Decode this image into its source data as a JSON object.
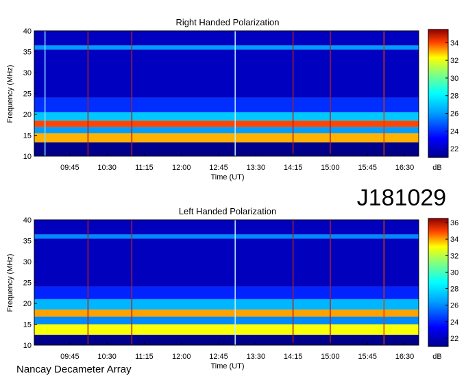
{
  "station_label": "J181029",
  "footer_label": "Nancay Decameter Array",
  "chart_data": [
    {
      "type": "heatmap",
      "title": "Right Handed Polarization",
      "xlabel": "Time (UT)",
      "ylabel": "Frequency (MHz)",
      "x_ticks": [
        "09:45",
        "10:30",
        "11:15",
        "12:00",
        "12:45",
        "13:30",
        "14:15",
        "15:00",
        "15:45",
        "16:30"
      ],
      "y_ticks": [
        10,
        15,
        20,
        25,
        30,
        35,
        40
      ],
      "ylim": [
        10,
        40
      ],
      "xlim": [
        "09:02",
        "16:47"
      ],
      "colorbar": {
        "unit": "dB",
        "ticks": [
          22,
          24,
          26,
          28,
          30,
          32,
          34
        ],
        "range": [
          21,
          35.5
        ]
      },
      "bands": [
        {
          "freq": [
            10,
            13.3
          ],
          "value": 21
        },
        {
          "freq": [
            13.3,
            15.5
          ],
          "value": 33
        },
        {
          "freq": [
            15.5,
            17.0
          ],
          "value": 26
        },
        {
          "freq": [
            17.0,
            18.5
          ],
          "value": 34
        },
        {
          "freq": [
            18.5,
            20.5
          ],
          "value": 27
        },
        {
          "freq": [
            20.5,
            24.0
          ],
          "value": 24
        },
        {
          "freq": [
            24.0,
            35.5
          ],
          "value": 22
        },
        {
          "freq": [
            35.5,
            36.5
          ],
          "value": 26
        },
        {
          "freq": [
            36.5,
            40
          ],
          "value": 22
        }
      ],
      "vertical_lines": [
        {
          "time": "09:15",
          "color": "#88ddff"
        },
        {
          "time": "10:07",
          "color": "#b02020"
        },
        {
          "time": "11:00",
          "color": "#b02020"
        },
        {
          "time": "13:05",
          "color": "#c0f0ff"
        },
        {
          "time": "14:15",
          "color": "#b02020"
        },
        {
          "time": "15:00",
          "color": "#b02020"
        },
        {
          "time": "16:05",
          "color": "#d04000"
        }
      ]
    },
    {
      "type": "heatmap",
      "title": "Left Handed Polarization",
      "xlabel": "Time (UT)",
      "ylabel": "Frequency (MHz)",
      "x_ticks": [
        "09:45",
        "10:30",
        "11:15",
        "12:00",
        "12:45",
        "13:30",
        "14:15",
        "15:00",
        "15:45",
        "16:30"
      ],
      "y_ticks": [
        10,
        15,
        20,
        25,
        30,
        35,
        40
      ],
      "ylim": [
        10,
        40
      ],
      "xlim": [
        "09:02",
        "16:47"
      ],
      "colorbar": {
        "unit": "dB",
        "ticks": [
          22,
          24,
          26,
          28,
          30,
          32,
          34,
          36
        ],
        "range": [
          21,
          36.5
        ]
      },
      "bands": [
        {
          "freq": [
            10,
            12.5
          ],
          "value": 21
        },
        {
          "freq": [
            12.5,
            15.0
          ],
          "value": 33
        },
        {
          "freq": [
            15.0,
            16.8
          ],
          "value": 26
        },
        {
          "freq": [
            16.8,
            18.5
          ],
          "value": 34
        },
        {
          "freq": [
            18.5,
            21.0
          ],
          "value": 27
        },
        {
          "freq": [
            21.0,
            24.0
          ],
          "value": 24
        },
        {
          "freq": [
            24.0,
            35.5
          ],
          "value": 22
        },
        {
          "freq": [
            35.5,
            36.5
          ],
          "value": 26
        },
        {
          "freq": [
            36.5,
            40
          ],
          "value": 22
        }
      ],
      "vertical_lines": [
        {
          "time": "10:07",
          "color": "#b02020"
        },
        {
          "time": "11:00",
          "color": "#b02020"
        },
        {
          "time": "13:05",
          "color": "#c0f0ff"
        },
        {
          "time": "14:15",
          "color": "#b02020"
        },
        {
          "time": "15:00",
          "color": "#b02020"
        },
        {
          "time": "16:05",
          "color": "#d04000"
        }
      ]
    }
  ]
}
